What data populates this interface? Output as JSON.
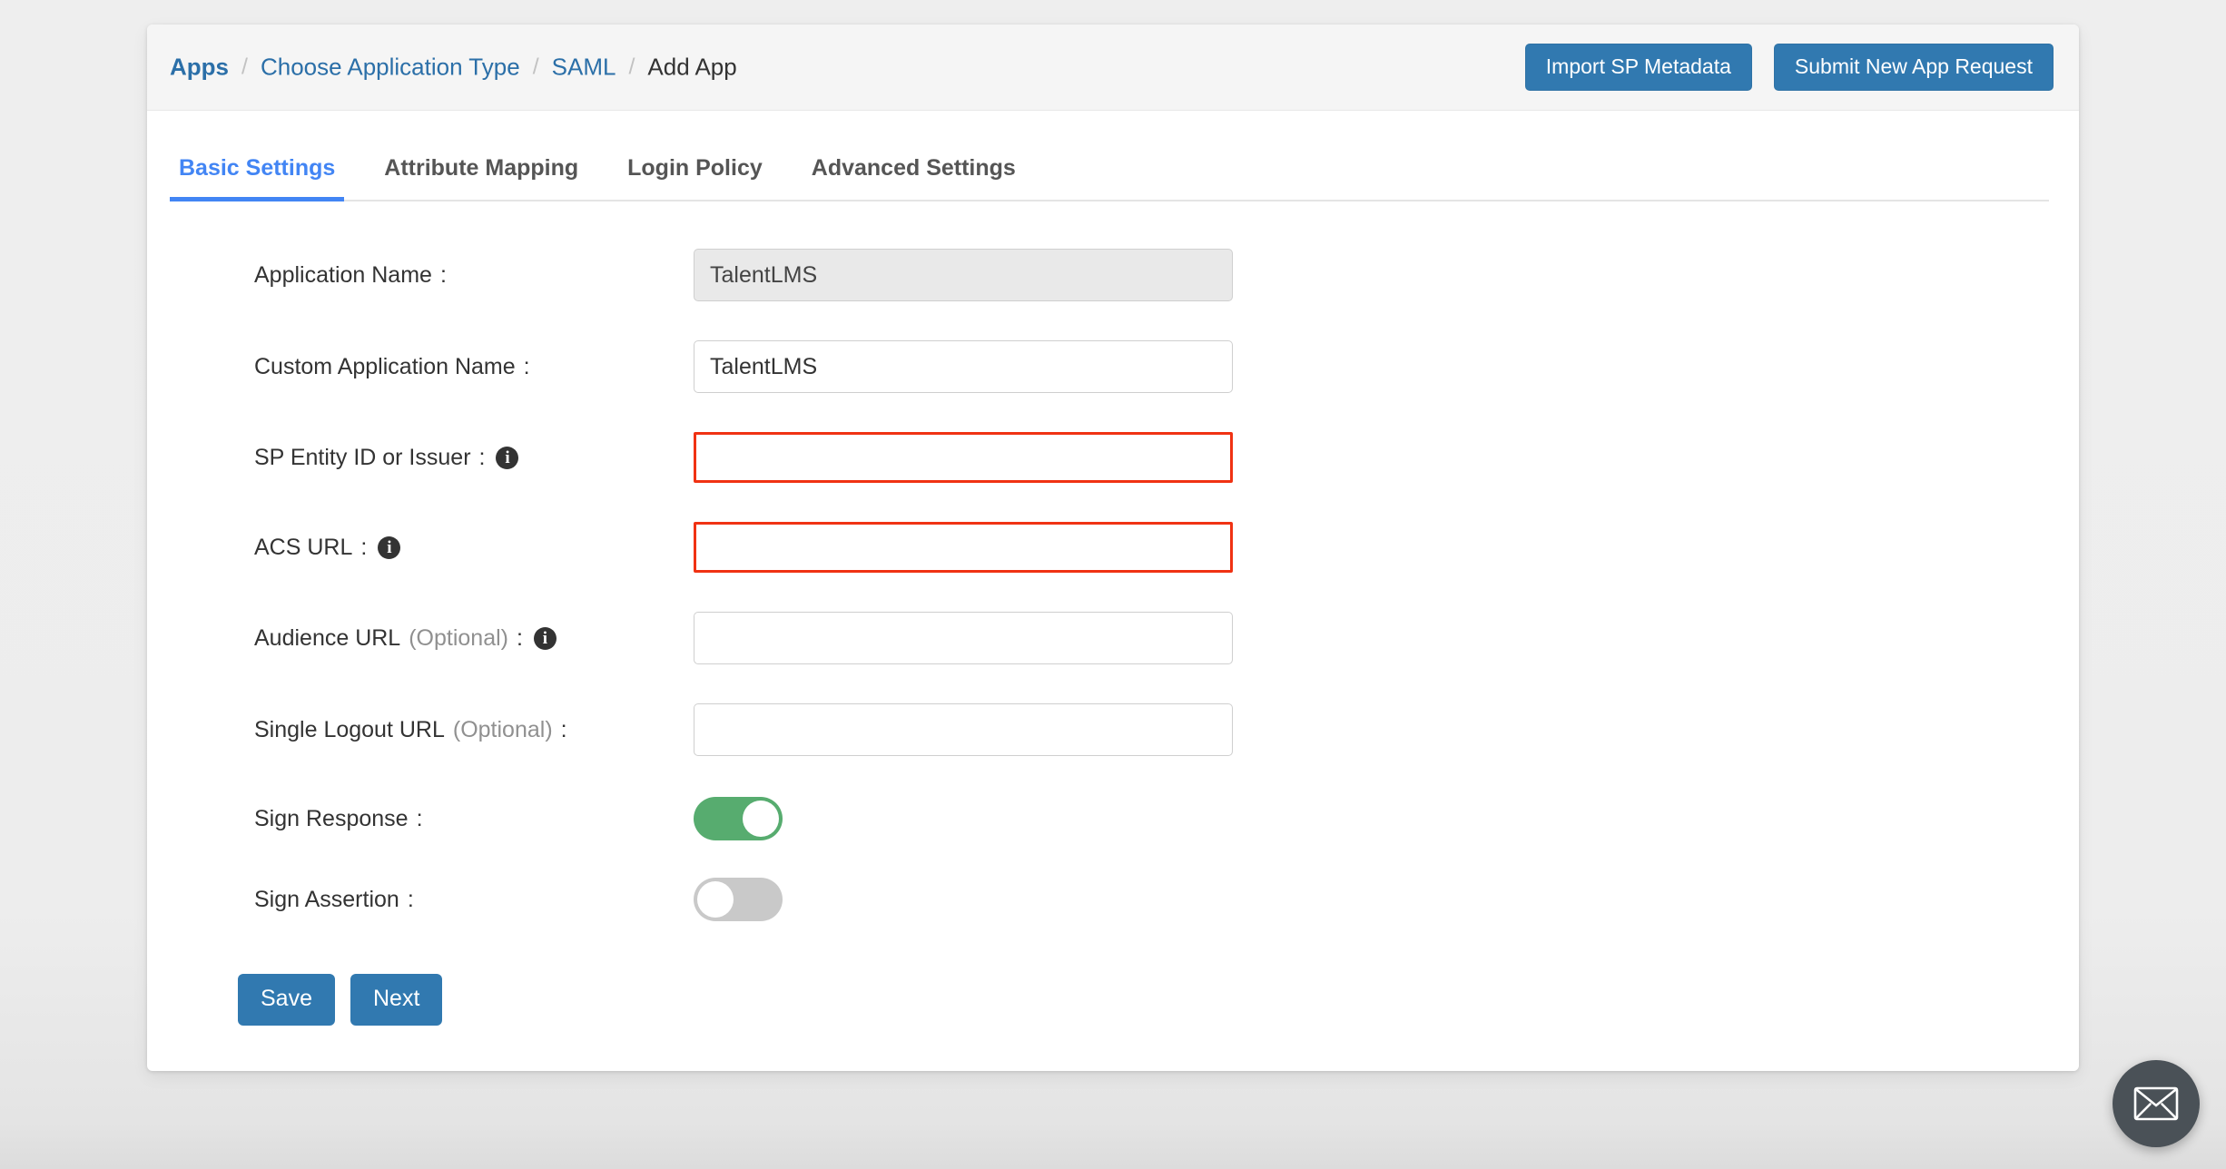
{
  "breadcrumb": {
    "items": [
      {
        "label": "Apps",
        "type": "link",
        "bold": true
      },
      {
        "label": "Choose Application Type",
        "type": "link"
      },
      {
        "label": "SAML",
        "type": "link"
      },
      {
        "label": "Add App",
        "type": "current"
      }
    ],
    "separator": "/"
  },
  "header": {
    "import_button": "Import SP Metadata",
    "submit_button": "Submit New App Request"
  },
  "tabs": [
    {
      "label": "Basic Settings",
      "active": true
    },
    {
      "label": "Attribute Mapping",
      "active": false
    },
    {
      "label": "Login Policy",
      "active": false
    },
    {
      "label": "Advanced Settings",
      "active": false
    }
  ],
  "form": {
    "application_name": {
      "label": "Application Name",
      "colon": ":",
      "value": "TalentLMS",
      "disabled": true
    },
    "custom_application_name": {
      "label": "Custom Application Name",
      "colon": ":",
      "value": "TalentLMS"
    },
    "sp_entity_id": {
      "label": "SP Entity ID or Issuer",
      "colon": ":",
      "value": "",
      "info_icon": "info-icon",
      "error": true
    },
    "acs_url": {
      "label": "ACS URL",
      "colon": ":",
      "value": "",
      "info_icon": "info-icon",
      "error": true
    },
    "audience_url": {
      "label": "Audience URL",
      "optional": "(Optional)",
      "colon": ":",
      "value": "",
      "info_icon": "info-icon"
    },
    "single_logout_url": {
      "label": "Single Logout URL",
      "optional": "(Optional)",
      "colon": ":",
      "value": ""
    },
    "sign_response": {
      "label": "Sign Response",
      "colon": ":",
      "state": "on"
    },
    "sign_assertion": {
      "label": "Sign Assertion",
      "colon": ":",
      "state": "off"
    },
    "save_button": "Save",
    "next_button": "Next"
  },
  "fab": {
    "icon": "envelope-icon"
  },
  "colors": {
    "primary_blue": "#3179b0",
    "link_blue": "#2b6fa8",
    "tab_active_blue": "#4285f4",
    "error_red": "#f03213",
    "toggle_on_green": "#57ac6f",
    "toggle_off_gray": "#c9c9c9",
    "fab_dark": "#4a5157",
    "page_background": "#ededed",
    "header_strip": "#f5f5f5"
  }
}
